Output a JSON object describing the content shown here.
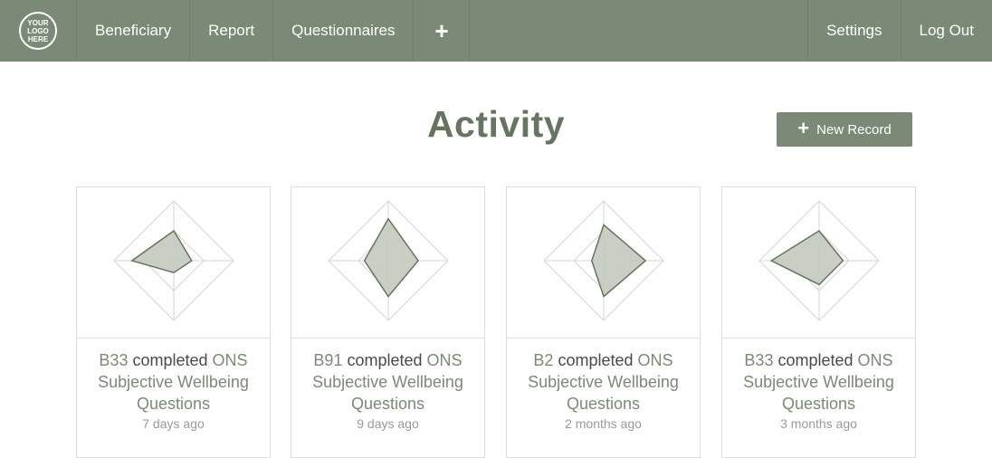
{
  "nav": {
    "logo_text": "YOUR LOGO HERE",
    "items": [
      "Beneficiary",
      "Report",
      "Questionnaires"
    ],
    "plus": "+",
    "settings": "Settings",
    "logout": "Log Out"
  },
  "page": {
    "title": "Activity",
    "new_record_label": "New Record",
    "new_record_icon": "+"
  },
  "colors": {
    "primary": "#7b8a77",
    "title": "#66755f",
    "radar_fill": "#c3cabf",
    "radar_stroke": "#66755f"
  },
  "activities": [
    {
      "beneficiary": "B33",
      "verb": "completed",
      "questionnaire": "ONS Subjective Wellbeing Questions",
      "time": "7 days ago",
      "radar": [
        0.5,
        0.3,
        0.2,
        0.7
      ]
    },
    {
      "beneficiary": "B91",
      "verb": "completed",
      "questionnaire": "ONS Subjective Wellbeing Questions",
      "time": "9 days ago",
      "radar": [
        0.7,
        0.5,
        0.6,
        0.4
      ]
    },
    {
      "beneficiary": "B2",
      "verb": "completed",
      "questionnaire": "ONS Subjective Wellbeing Questions",
      "time": "2 months ago",
      "radar": [
        0.6,
        0.7,
        0.6,
        0.2
      ]
    },
    {
      "beneficiary": "B33",
      "verb": "completed",
      "questionnaire": "ONS Subjective Wellbeing Questions",
      "time": "3 months ago",
      "radar": [
        0.5,
        0.4,
        0.4,
        0.8
      ]
    }
  ]
}
